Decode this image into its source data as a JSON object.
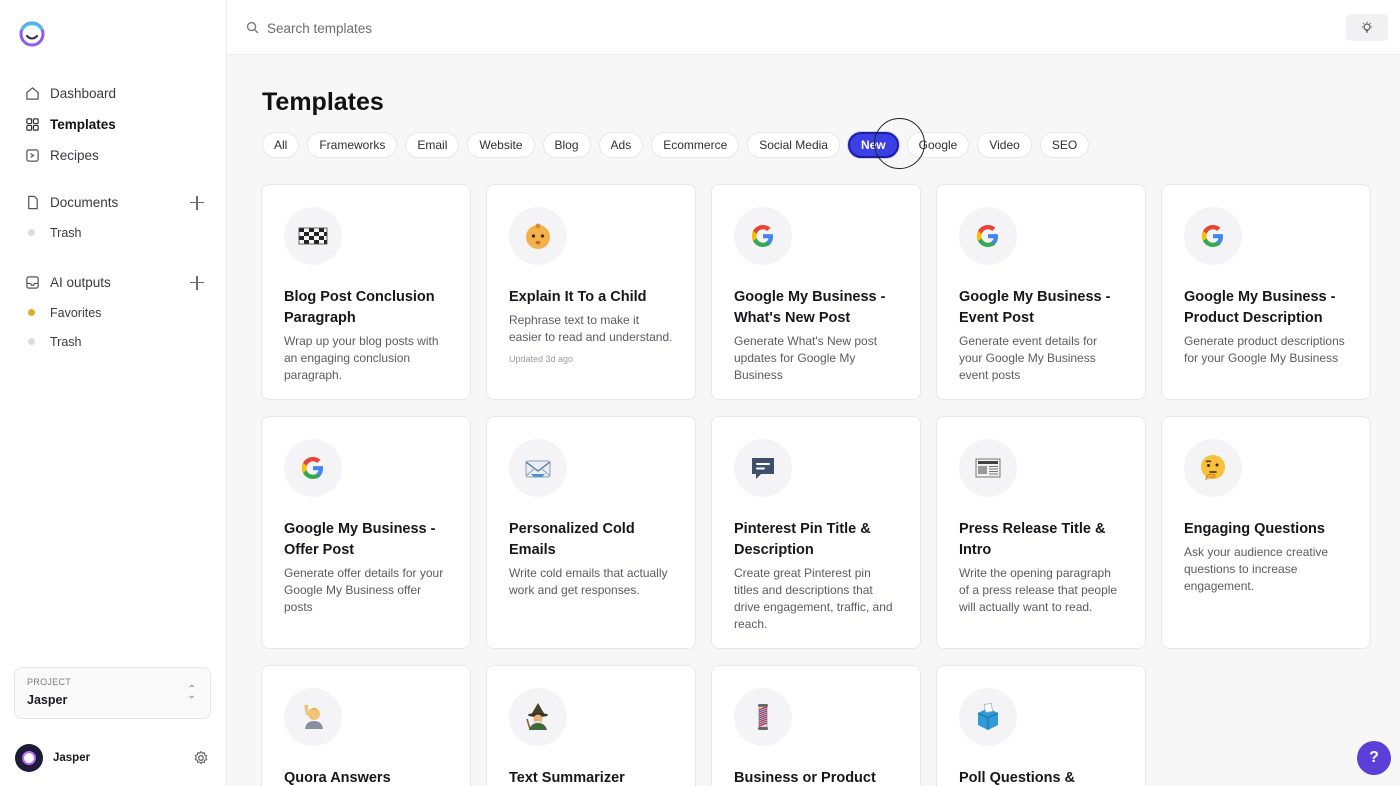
{
  "sidebar": {
    "nav": [
      {
        "label": "Dashboard",
        "icon": "home-icon"
      },
      {
        "label": "Templates",
        "icon": "grid-icon"
      },
      {
        "label": "Recipes",
        "icon": "recipe-icon"
      }
    ],
    "documents": {
      "label": "Documents",
      "items": [
        {
          "label": "Trash"
        }
      ]
    },
    "ai_outputs": {
      "label": "AI outputs",
      "items": [
        {
          "label": "Favorites"
        },
        {
          "label": "Trash"
        }
      ]
    },
    "project": {
      "label": "PROJECT",
      "value": "Jasper"
    },
    "user": {
      "name": "Jasper"
    }
  },
  "search": {
    "placeholder": "Search templates"
  },
  "page": {
    "title": "Templates"
  },
  "filters": [
    "All",
    "Frameworks",
    "Email",
    "Website",
    "Blog",
    "Ads",
    "Ecommerce",
    "Social Media",
    "New",
    "Google",
    "Video",
    "SEO"
  ],
  "active_filter": "New",
  "cards": [
    {
      "title": "Blog Post Conclusion Paragraph",
      "desc": "Wrap up your blog posts with an engaging conclusion paragraph.",
      "icon": "checkered-flag-icon"
    },
    {
      "title": "Explain It To a Child",
      "desc": "Rephrase text to make it easier to read and understand.",
      "updated": "Updated 3d ago",
      "icon": "baby-icon"
    },
    {
      "title": "Google My Business - What's New Post",
      "desc": "Generate What's New post updates for Google My Business",
      "icon": "google-icon"
    },
    {
      "title": "Google My Business - Event Post",
      "desc": "Generate event details for your Google My Business event posts",
      "icon": "google-icon"
    },
    {
      "title": "Google My Business - Product Description",
      "desc": "Generate product descriptions for your Google My Business",
      "icon": "google-icon"
    },
    {
      "title": "Google My Business - Offer Post",
      "desc": "Generate offer details for your Google My Business offer posts",
      "icon": "google-icon"
    },
    {
      "title": "Personalized Cold Emails",
      "desc": "Write cold emails that actually work and get responses.",
      "icon": "envelope-icon"
    },
    {
      "title": "Pinterest Pin Title & Description",
      "desc": "Create great Pinterest pin titles and descriptions that drive engagement, traffic, and reach.",
      "icon": "message-icon"
    },
    {
      "title": "Press Release Title & Intro",
      "desc": "Write the opening paragraph of a press release that people will actually want to read.",
      "icon": "newspaper-icon"
    },
    {
      "title": "Engaging Questions",
      "desc": "Ask your audience creative questions to increase engagement.",
      "icon": "thinking-face-icon"
    },
    {
      "title": "Quora Answers",
      "desc": "",
      "icon": "raising-hand-icon"
    },
    {
      "title": "Text Summarizer",
      "desc": "",
      "icon": "wizard-icon"
    },
    {
      "title": "Business or Product",
      "desc": "",
      "icon": "barber-pole-icon"
    },
    {
      "title": "Poll Questions &",
      "desc": "",
      "icon": "ballot-box-icon"
    }
  ],
  "help": {
    "label": "?"
  },
  "colors": {
    "accent": "#3b3fe6",
    "help": "#5b3fd9"
  }
}
